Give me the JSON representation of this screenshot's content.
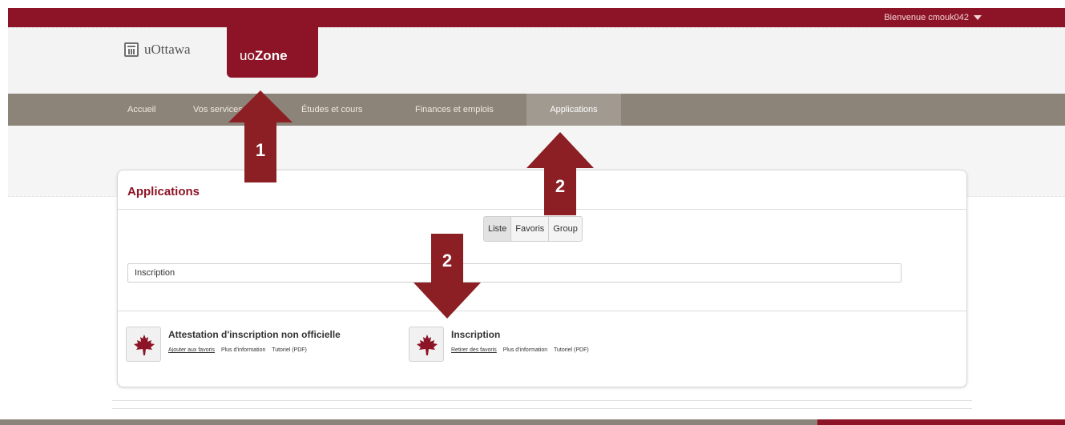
{
  "topbar": {
    "welcome": "Bienvenue cmouk042"
  },
  "brand": {
    "logo_text": "uOttawa",
    "tab_prefix": "uo",
    "tab_bold": "Zone"
  },
  "nav": {
    "items": [
      {
        "label": "Accueil"
      },
      {
        "label": "Vos services"
      },
      {
        "label": "Études et cours"
      },
      {
        "label": "Finances et emplois"
      },
      {
        "label": "Applications"
      }
    ]
  },
  "panel": {
    "title": "Applications",
    "view_toggle": [
      "Liste",
      "Favoris",
      "Group"
    ],
    "search_value": "Inscription"
  },
  "apps": [
    {
      "name": "Attestation d'inscription non officielle",
      "links": [
        "Ajouter aux favoris",
        "Plus d'information",
        "Tutoriel (PDF)"
      ]
    },
    {
      "name": "Inscription",
      "links": [
        "Retirer des favoris",
        "Plus d'information",
        "Tutoriel (PDF)"
      ]
    }
  ],
  "annotations": [
    "1",
    "2",
    "2"
  ],
  "colors": {
    "brand_red": "#8c1426",
    "nav_gray": "#8d8479",
    "arrow_red": "#8b1f23"
  }
}
